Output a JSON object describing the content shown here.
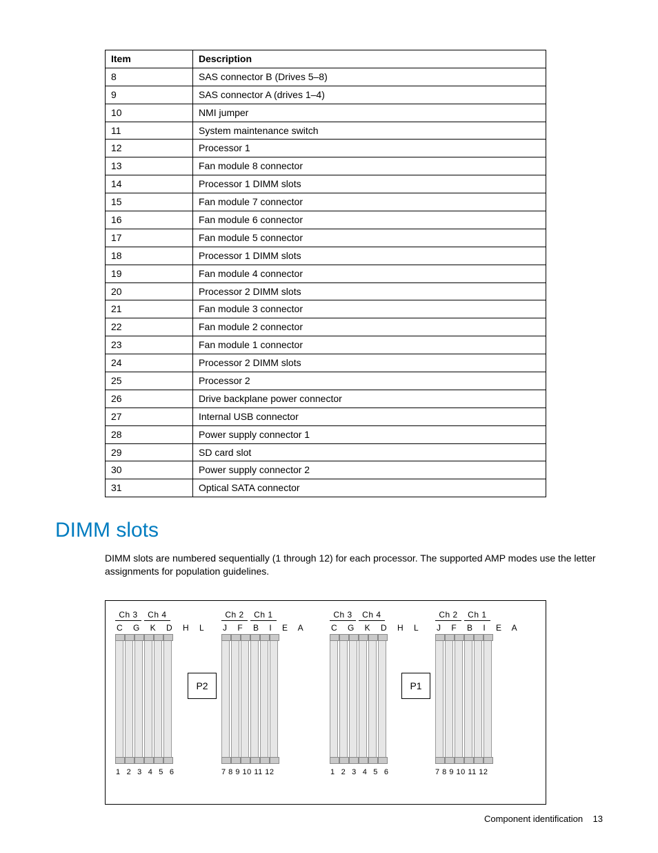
{
  "table": {
    "headers": [
      "Item",
      "Description"
    ],
    "rows": [
      {
        "item": "8",
        "desc": "SAS connector B (Drives 5–8)"
      },
      {
        "item": "9",
        "desc": "SAS connector A (drives 1–4)"
      },
      {
        "item": "10",
        "desc": "NMI jumper"
      },
      {
        "item": "11",
        "desc": "System maintenance switch"
      },
      {
        "item": "12",
        "desc": "Processor 1"
      },
      {
        "item": "13",
        "desc": "Fan module 8 connector"
      },
      {
        "item": "14",
        "desc": "Processor 1 DIMM slots"
      },
      {
        "item": "15",
        "desc": "Fan module 7 connector"
      },
      {
        "item": "16",
        "desc": "Fan module 6 connector"
      },
      {
        "item": "17",
        "desc": "Fan module 5 connector"
      },
      {
        "item": "18",
        "desc": "Processor 1 DIMM slots"
      },
      {
        "item": "19",
        "desc": "Fan module 4 connector"
      },
      {
        "item": "20",
        "desc": "Processor 2 DIMM slots"
      },
      {
        "item": "21",
        "desc": "Fan module 3 connector"
      },
      {
        "item": "22",
        "desc": "Fan module 2 connector"
      },
      {
        "item": "23",
        "desc": "Fan module 1 connector"
      },
      {
        "item": "24",
        "desc": "Processor 2 DIMM slots"
      },
      {
        "item": "25",
        "desc": "Processor 2"
      },
      {
        "item": "26",
        "desc": "Drive backplane power connector"
      },
      {
        "item": "27",
        "desc": "Internal USB connector"
      },
      {
        "item": "28",
        "desc": "Power supply connector 1"
      },
      {
        "item": "29",
        "desc": "SD card slot"
      },
      {
        "item": "30",
        "desc": "Power supply connector 2"
      },
      {
        "item": "31",
        "desc": "Optical SATA connector"
      }
    ]
  },
  "section_title": "DIMM slots",
  "body_text": "DIMM slots are numbered sequentially (1 through 12) for each processor. The supported AMP modes use the letter assignments for population guidelines.",
  "diagram": {
    "groups": [
      {
        "ch": [
          "Ch 3",
          "Ch 4"
        ],
        "letters": "C G K D H L",
        "nums": "1  2  3  4  5  6"
      },
      {
        "ch": [
          "Ch 2",
          "Ch 1"
        ],
        "letters": "J  F  B  I  E  A",
        "nums": "7  8  9 10 11 12"
      },
      {
        "ch": [
          "Ch 3",
          "Ch 4"
        ],
        "letters": "C G K D H L",
        "nums": "1  2  3  4  5  6"
      },
      {
        "ch": [
          "Ch 2",
          "Ch 1"
        ],
        "letters": "J  F  B  I  E  A",
        "nums": "7  8  9 10 11 12"
      }
    ],
    "proc_labels": {
      "p1": "P1",
      "p2": "P2"
    }
  },
  "footer": {
    "section": "Component identification",
    "page": "13"
  }
}
